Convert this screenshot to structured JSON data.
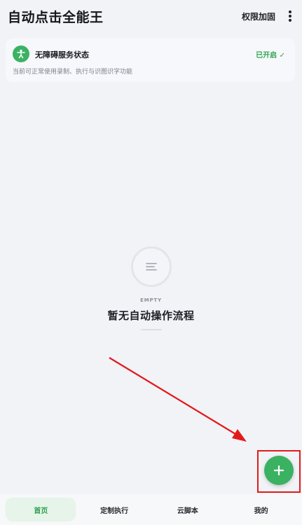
{
  "app": {
    "title": "自动点击全能王"
  },
  "header": {
    "action_label": "权限加固"
  },
  "service_card": {
    "title": "无障碍服务状态",
    "status": "已开启 ✓",
    "description": "当前可正常使用录制、执行与识图识字功能"
  },
  "empty_state": {
    "label": "EMPTY",
    "title": "暂无自动操作流程"
  },
  "bottom_nav": {
    "items": [
      {
        "label": "首页"
      },
      {
        "label": "定制执行"
      },
      {
        "label": "云脚本"
      },
      {
        "label": "我的"
      }
    ]
  },
  "colors": {
    "accent": "#3bb262",
    "annotation": "#e31a1a"
  }
}
